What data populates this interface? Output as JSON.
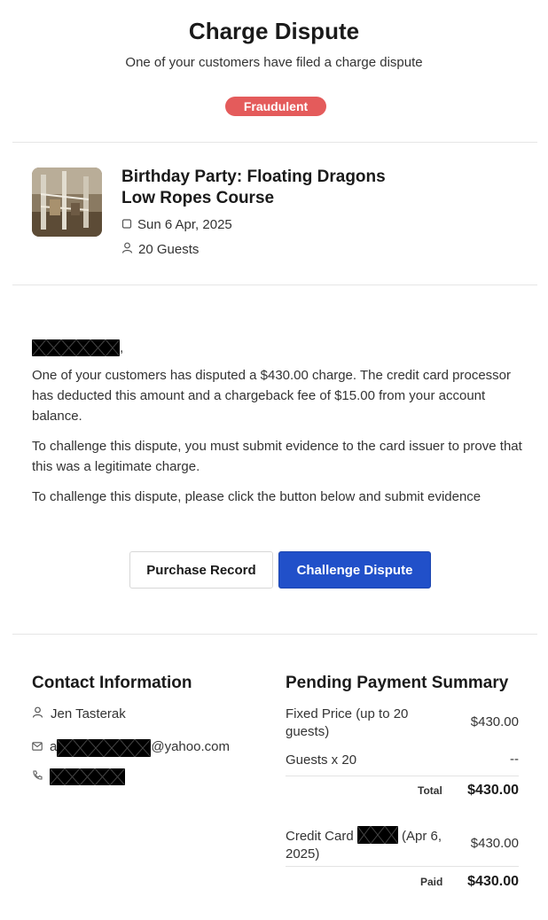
{
  "header": {
    "title": "Charge Dispute",
    "subtitle": "One of your customers have filed a charge dispute",
    "badge": "Fraudulent"
  },
  "event": {
    "title": "Birthday Party: Floating Dragons Low Ropes Course",
    "date": "Sun 6 Apr, 2025",
    "guests": "20 Guests"
  },
  "message": {
    "greeting_suffix": ",",
    "para1": "One of your customers has disputed a $430.00 charge. The credit card processor has deducted this amount and a chargeback fee of $15.00 from your account balance.",
    "para2": "To challenge this dispute, you must submit evidence to the card issuer to prove that this was a legitimate charge.",
    "para3": "To challenge this dispute, please click the button below and submit evidence"
  },
  "actions": {
    "purchase_record": "Purchase Record",
    "challenge": "Challenge Dispute"
  },
  "contact": {
    "title": "Contact Information",
    "name": "Jen Tasterak",
    "email_prefix": "a",
    "email_suffix": "@yahoo.com"
  },
  "payment": {
    "title": "Pending Payment Summary",
    "items": [
      {
        "label": "Fixed Price (up to 20 guests)",
        "amount": "$430.00"
      },
      {
        "label": "Guests x 20",
        "amount": "--"
      }
    ],
    "total_label": "Total",
    "total_amount": "$430.00",
    "card_label_a": "Credit Card",
    "card_label_b": "(Apr 6, 2025)",
    "card_amount": "$430.00",
    "paid_label": "Paid",
    "paid_amount": "$430.00"
  },
  "colors": {
    "badge": "#e45b5b",
    "primary_button": "#2150c9"
  }
}
